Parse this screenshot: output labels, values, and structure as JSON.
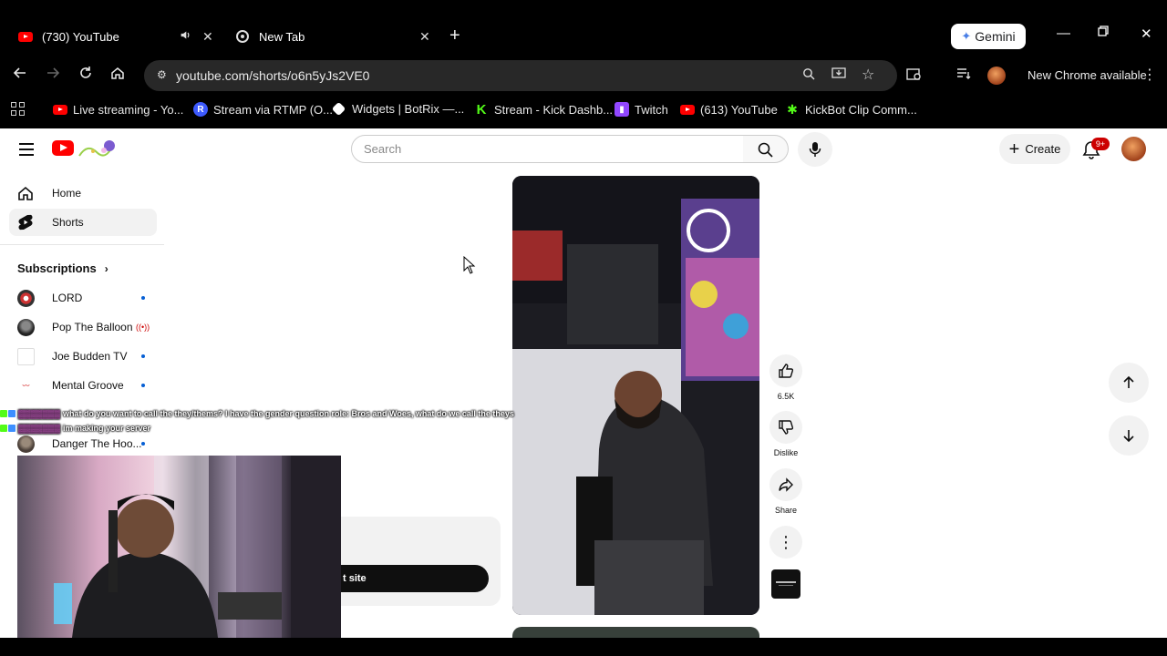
{
  "browser": {
    "tabs": [
      {
        "title": "(730) YouTube",
        "icon": "youtube-icon",
        "audio": true
      },
      {
        "title": "New Tab",
        "icon": "chrome-icon"
      }
    ],
    "gemini_label": "Gemini",
    "url": "youtube.com/shorts/o6n5yJs2VE0",
    "update_label": "New Chrome available",
    "bookmarks": [
      {
        "label": "Live streaming - Yo...",
        "icon": "youtube-icon"
      },
      {
        "label": "Stream via RTMP (O...",
        "icon": "restream-icon"
      },
      {
        "label": "Widgets | BotRix —...",
        "icon": "botrix-icon"
      },
      {
        "label": "Stream - Kick Dashb...",
        "icon": "kick-icon"
      },
      {
        "label": "Twitch",
        "icon": "twitch-icon"
      },
      {
        "label": "(613) YouTube",
        "icon": "youtube-icon"
      },
      {
        "label": "KickBot Clip Comm...",
        "icon": "kickbot-icon"
      }
    ]
  },
  "youtube": {
    "search_placeholder": "Search",
    "create_label": "Create",
    "notification_count": "9+",
    "sidebar": {
      "items": [
        {
          "label": "Home",
          "icon": "home-icon"
        },
        {
          "label": "Shorts",
          "icon": "shorts-icon",
          "active": true
        }
      ],
      "subscriptions_title": "Subscriptions",
      "subscriptions": [
        {
          "name": "LORD",
          "status": "new"
        },
        {
          "name": "Pop The Balloon",
          "status": "live"
        },
        {
          "name": "Joe Budden TV",
          "status": "new"
        },
        {
          "name": "Mental Groove",
          "status": "new"
        },
        {
          "name": "Danger The Hoo...",
          "status": "new"
        }
      ]
    },
    "short": {
      "like_count": "6.5K",
      "dislike_label": "Dislike",
      "share_label": "Share"
    },
    "promo_button_label": "t site"
  },
  "stream_overlay": {
    "chat": [
      {
        "message": "what do you want to call the they/thems? I have the gender question role: Bros and Woes, what do we call the theys"
      },
      {
        "message": "im making your server"
      }
    ]
  }
}
